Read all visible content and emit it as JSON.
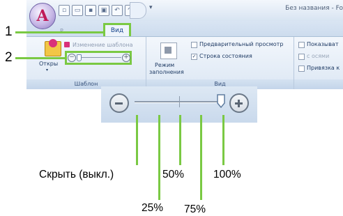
{
  "app": {
    "logo_letter": "A",
    "window_title": "Без названия - Fo"
  },
  "ribbon": {
    "tab_active": "Вид",
    "tab_inactive": "Р...",
    "groups": {
      "template": {
        "label": "Шаблон",
        "open_button": "Откры",
        "change_template": "Изменение шаблона"
      },
      "view": {
        "label": "Вид",
        "fill_mode_line1": "Режим",
        "fill_mode_line2": "заполнения",
        "preview": {
          "label": "Предварительный просмотр",
          "checked": false
        },
        "status_bar": {
          "label": "Строка состояния",
          "checked": true
        }
      },
      "extra": {
        "show": "Показыват",
        "with_axes": "с осями",
        "snap": "Привязка к"
      }
    }
  },
  "callouts": {
    "one": "1",
    "two": "2"
  },
  "zoom_slider": {
    "minus_icon": "zoom-out-icon",
    "plus_icon": "zoom-in-icon",
    "levels": {
      "off": "Скрыть (выкл.)",
      "p25": "25%",
      "p50": "50%",
      "p75": "75%",
      "p100": "100%"
    },
    "current_level_percent": 100
  },
  "colors": {
    "highlight": "#7ac943",
    "ribbon_text": "#15428b"
  }
}
